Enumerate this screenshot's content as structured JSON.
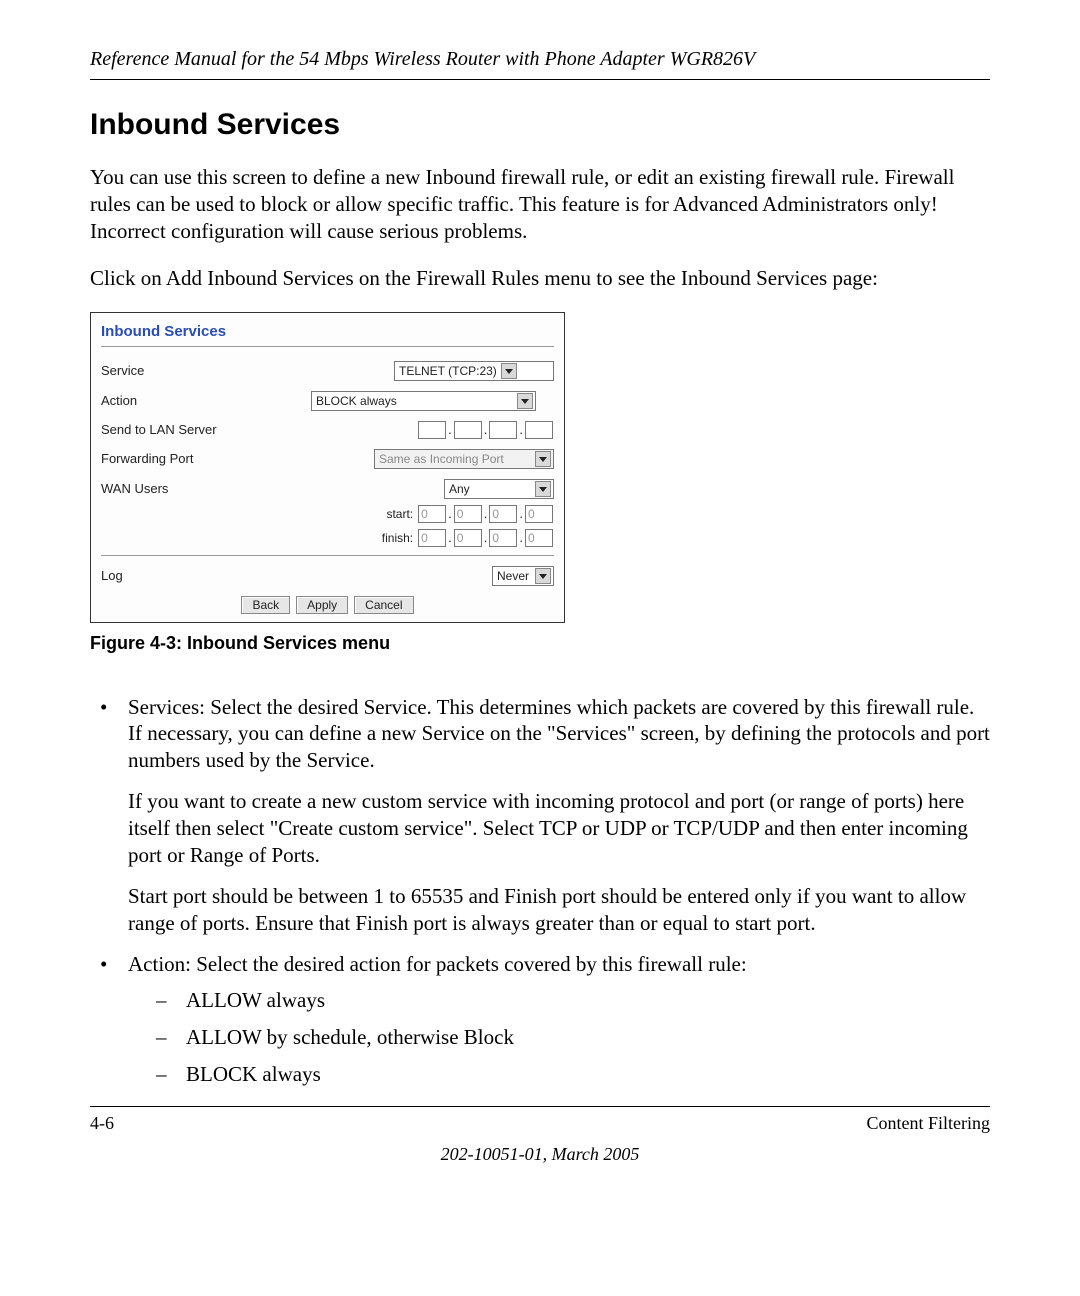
{
  "header": {
    "running_title": "Reference Manual for the 54 Mbps Wireless Router with Phone Adapter WGR826V"
  },
  "section": {
    "title": "Inbound Services",
    "intro_p1": "You can use this screen to define a new Inbound firewall rule, or edit an existing firewall rule. Firewall rules can be used to block or allow specific traffic. This feature is for Advanced Administrators only! Incorrect configuration will cause serious problems.",
    "intro_p2": "Click on Add Inbound Services on the Firewall Rules menu to see the Inbound Services page:"
  },
  "screenshot": {
    "panel_title": "Inbound Services",
    "labels": {
      "service": "Service",
      "action": "Action",
      "send_to_lan": "Send to LAN Server",
      "forwarding_port": "Forwarding Port",
      "wan_users": "WAN Users",
      "start": "start:",
      "finish": "finish:",
      "log": "Log"
    },
    "values": {
      "service": "TELNET (TCP:23)",
      "action": "BLOCK always",
      "forwarding_port": "Same as Incoming Port",
      "wan_users": "Any",
      "start": [
        "0",
        "0",
        "0",
        "0"
      ],
      "finish": [
        "0",
        "0",
        "0",
        "0"
      ],
      "lan_ip": [
        "",
        "",
        "",
        ""
      ],
      "log": "Never"
    },
    "buttons": {
      "back": "Back",
      "apply": "Apply",
      "cancel": "Cancel"
    }
  },
  "figure_caption": "Figure 4-3:  Inbound Services menu",
  "list": {
    "services_label": "Services: Select the desired Service. This determines which packets are covered by this firewall rule. If necessary, you can define a new Service on the \"Services\" screen, by defining the protocols and port numbers used by the Service.",
    "services_p2": "If you want to create a new custom service with incoming protocol and port (or range of ports) here itself then select \"Create custom service\". Select TCP or UDP or TCP/UDP and then enter incoming port or Range of Ports.",
    "services_p3": "Start port should be between 1 to 65535 and Finish port should be entered only if you want to allow range of ports. Ensure that Finish port is always greater than or equal to start port.",
    "action_label": "Action: Select the desired action for packets covered by this firewall rule:",
    "action_opts": [
      "ALLOW always",
      "ALLOW by schedule, otherwise Block",
      "BLOCK always"
    ]
  },
  "footer": {
    "page_num": "4-6",
    "section_name": "Content Filtering",
    "doc_id": "202-10051-01, March 2005"
  }
}
